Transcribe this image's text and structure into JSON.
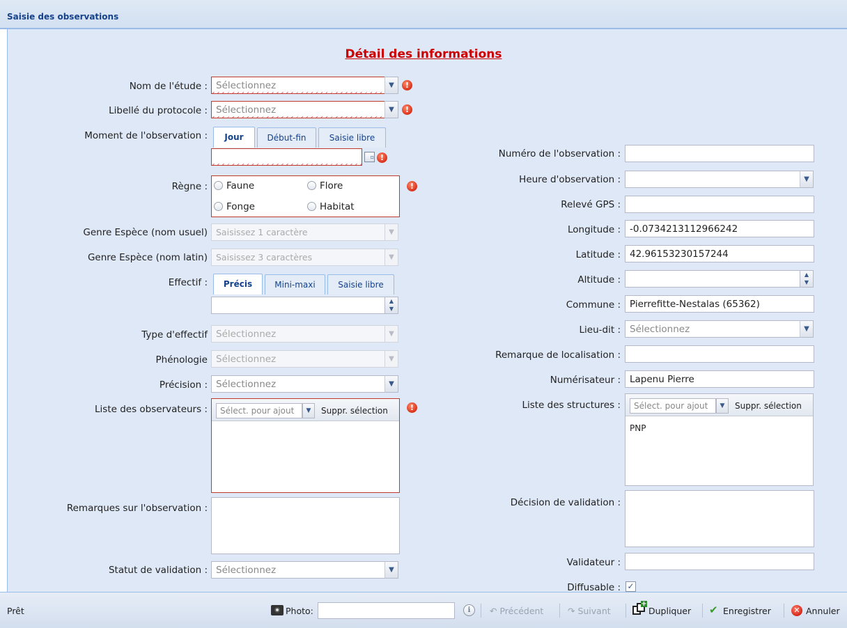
{
  "window": {
    "title": "Saisie des observations"
  },
  "form": {
    "heading": "Détail des informations",
    "nom_etude": {
      "label": "Nom de l'étude :",
      "placeholder": "Sélectionnez"
    },
    "libelle_protocole": {
      "label": "Libellé du protocole :",
      "placeholder": "Sélectionnez"
    },
    "moment": {
      "label": "Moment de l'observation :",
      "tabs": [
        "Jour",
        "Début-fin",
        "Saisie libre"
      ],
      "value": ""
    },
    "regne": {
      "label": "Règne :",
      "options": [
        "Faune",
        "Flore",
        "Fonge",
        "Habitat"
      ]
    },
    "genre_usuel": {
      "label": "Genre Espèce (nom usuel)",
      "placeholder": "Saisissez 1 caractère"
    },
    "genre_latin": {
      "label": "Genre Espèce (nom latin)",
      "placeholder": "Saisissez 3 caractères"
    },
    "effectif": {
      "label": "Effectif :",
      "tabs": [
        "Précis",
        "Mini-maxi",
        "Saisie libre"
      ],
      "value": ""
    },
    "type_effectif": {
      "label": "Type d'effectif",
      "placeholder": "Sélectionnez"
    },
    "phenologie": {
      "label": "Phénologie",
      "placeholder": "Sélectionnez"
    },
    "precision": {
      "label": "Précision :",
      "placeholder": "Sélectionnez"
    },
    "observateurs": {
      "label": "Liste des observateurs :",
      "select_placeholder": "Sélect. pour ajout",
      "remove_label": "Suppr. sélection",
      "items": []
    },
    "remarques": {
      "label": "Remarques sur l'observation :",
      "value": ""
    },
    "statut_validation": {
      "label": "Statut de validation :",
      "placeholder": "Sélectionnez"
    },
    "numero": {
      "label": "Numéro de l'observation :",
      "value": ""
    },
    "heure": {
      "label": "Heure d'observation :",
      "value": ""
    },
    "releve_gps": {
      "label": "Relevé GPS :",
      "value": ""
    },
    "longitude": {
      "label": "Longitude :",
      "value": "-0.0734213112966242"
    },
    "latitude": {
      "label": "Latitude :",
      "value": "42.96153230157244"
    },
    "altitude": {
      "label": "Altitude :",
      "value": ""
    },
    "commune": {
      "label": "Commune :",
      "value": "Pierrefitte-Nestalas (65362)"
    },
    "lieu_dit": {
      "label": "Lieu-dit :",
      "placeholder": "Sélectionnez"
    },
    "remarque_localisation": {
      "label": "Remarque de localisation :",
      "value": ""
    },
    "numerisateur": {
      "label": "Numérisateur :",
      "value": "Lapenu Pierre"
    },
    "structures": {
      "label": "Liste des structures :",
      "select_placeholder": "Sélect. pour ajout",
      "remove_label": "Suppr. sélection",
      "items": [
        "PNP"
      ]
    },
    "decision_validation": {
      "label": "Décision de validation :",
      "value": ""
    },
    "validateur": {
      "label": "Validateur :",
      "value": ""
    },
    "diffusable": {
      "label": "Diffusable :",
      "checked": true
    }
  },
  "statusbar": {
    "status": "Prêt",
    "photo_label": "Photo:",
    "photo_value": "",
    "previous_label": "Précédent",
    "next_label": "Suivant",
    "duplicate_label": "Dupliquer",
    "save_label": "Enregistrer",
    "cancel_label": "Annuler"
  },
  "colors": {
    "accent": "#15428b",
    "heading": "#cc0000",
    "error": "#d8311b",
    "panel_bg": "#dfe8f6"
  }
}
